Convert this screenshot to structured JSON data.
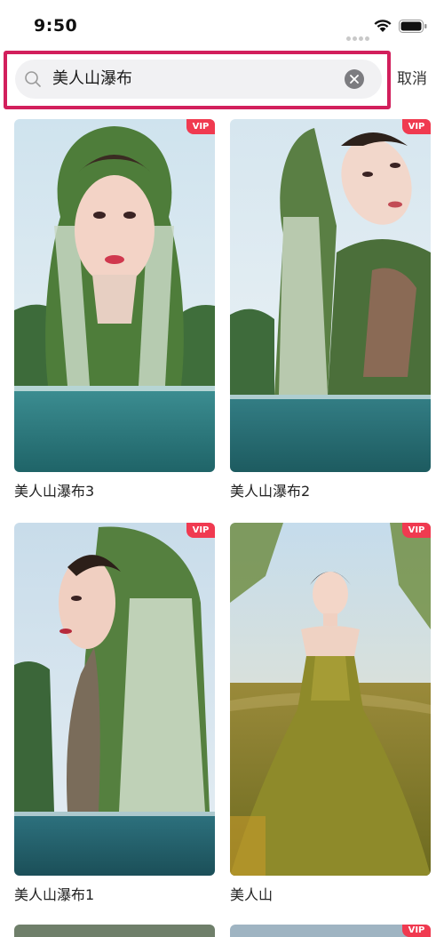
{
  "status_bar": {
    "time": "9:50"
  },
  "search": {
    "query": "美人山瀑布",
    "cancel_label": "取消"
  },
  "colors": {
    "highlight": "#d21f5c",
    "vip": "#f03a50"
  },
  "results": [
    {
      "title": "美人山瀑布3",
      "badge": "VIP"
    },
    {
      "title": "美人山瀑布2",
      "badge": "VIP"
    },
    {
      "title": "美人山瀑布1",
      "badge": "VIP"
    },
    {
      "title": "美人山",
      "badge": "VIP"
    }
  ],
  "more_row": {
    "badge": "VIP"
  }
}
